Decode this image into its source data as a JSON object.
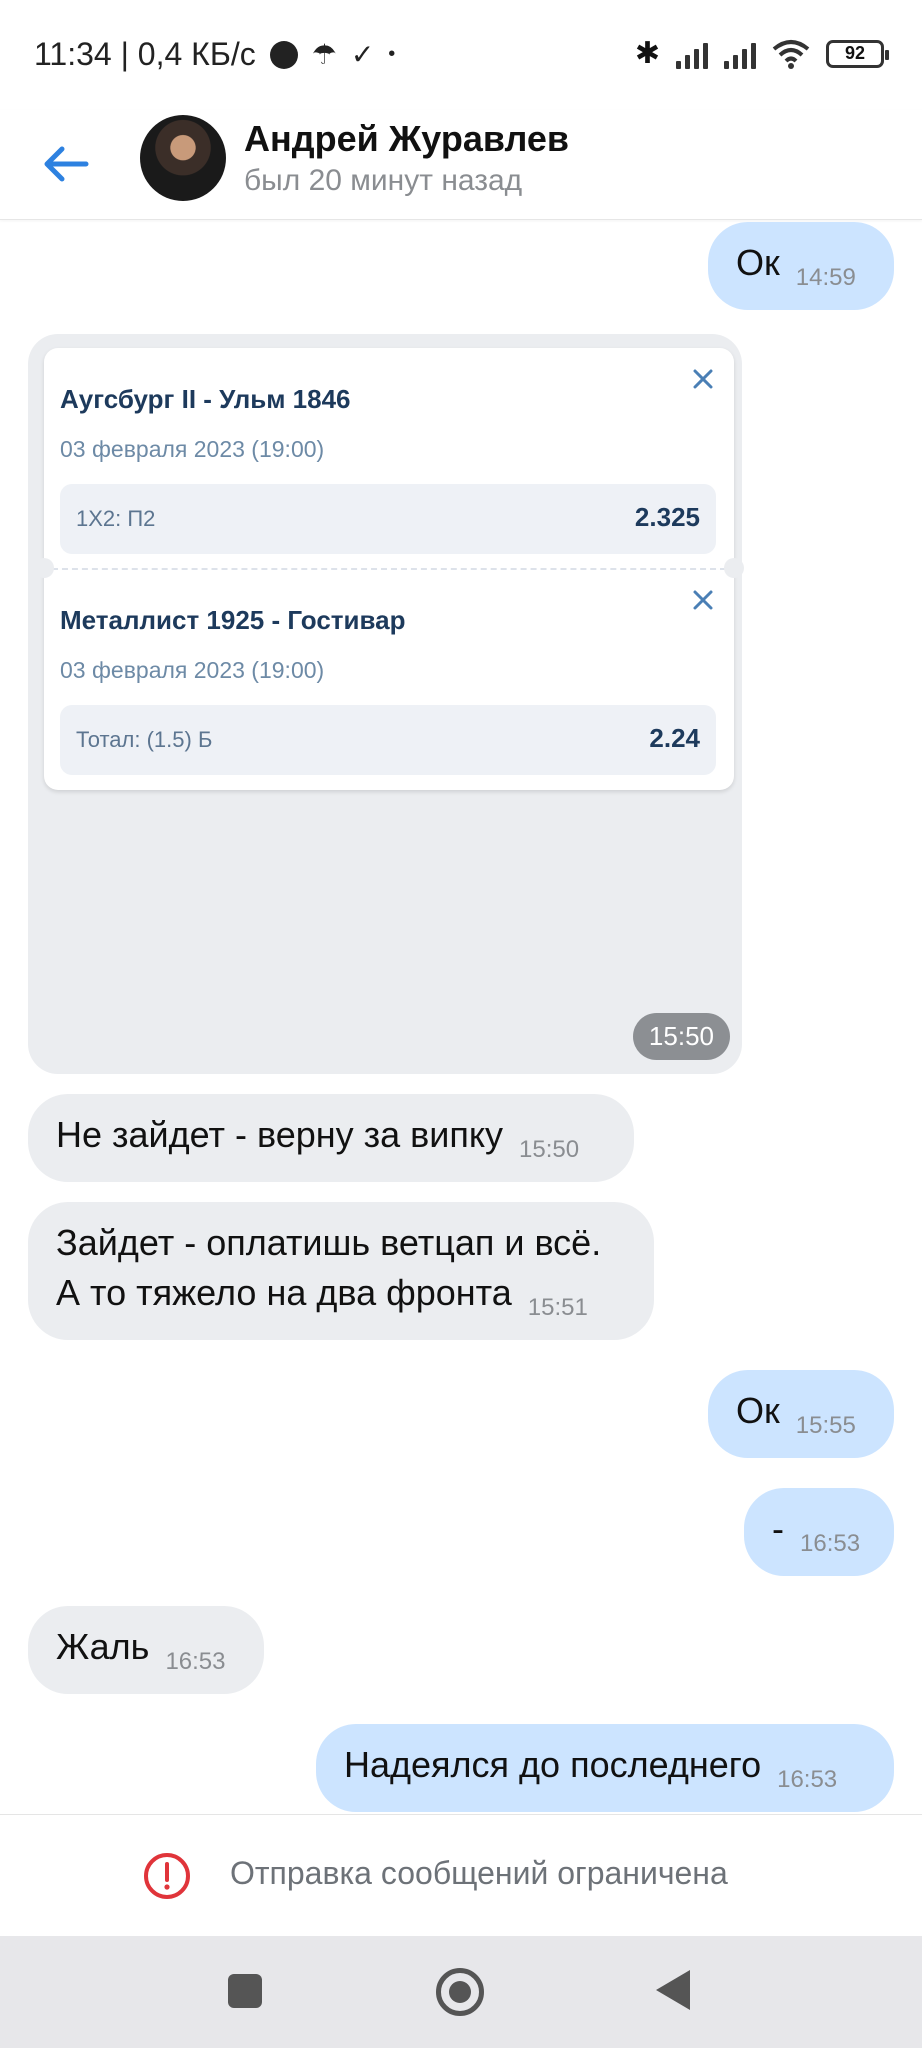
{
  "status_bar": {
    "time_speed": "11:34 | 0,4 КБ/с",
    "battery": "92"
  },
  "header": {
    "name": "Андрей Журавлев",
    "last_seen": "был 20 минут назад"
  },
  "messages": [
    {
      "dir": "out",
      "text": "Ок",
      "time": "14:59"
    },
    {
      "dir": "in",
      "text": "Не зайдет - верну за випку",
      "time": "15:50"
    },
    {
      "dir": "in",
      "text_line1": "Зайдет - оплатишь ветцап и всё.",
      "text_line2": "А то тяжело на два фронта",
      "time": "15:51"
    },
    {
      "dir": "out",
      "text": "Ок",
      "time": "15:55"
    },
    {
      "dir": "out",
      "text": "-",
      "time": "16:53"
    },
    {
      "dir": "in",
      "text": "Жаль",
      "time": "16:53"
    },
    {
      "dir": "out",
      "text": "Надеялся до последнего",
      "time": "16:53"
    }
  ],
  "coupon": {
    "time": "15:50",
    "bets": [
      {
        "match": "Аугсбург II - Ульм 1846",
        "date": "03 февраля 2023 (19:00)",
        "type": "1X2: П2",
        "odd": "2.325"
      },
      {
        "match": "Металлист 1925 - Гостивар",
        "date": "03 февраля 2023 (19:00)",
        "type": "Тотал: (1.5) Б",
        "odd": "2.24"
      }
    ]
  },
  "footer": {
    "restriction": "Отправка сообщений ограничена"
  },
  "colors": {
    "accent": "#2d81e0",
    "out_bubble": "#cce4ff",
    "in_bubble": "#ebedf0",
    "warning": "#e0343a"
  }
}
